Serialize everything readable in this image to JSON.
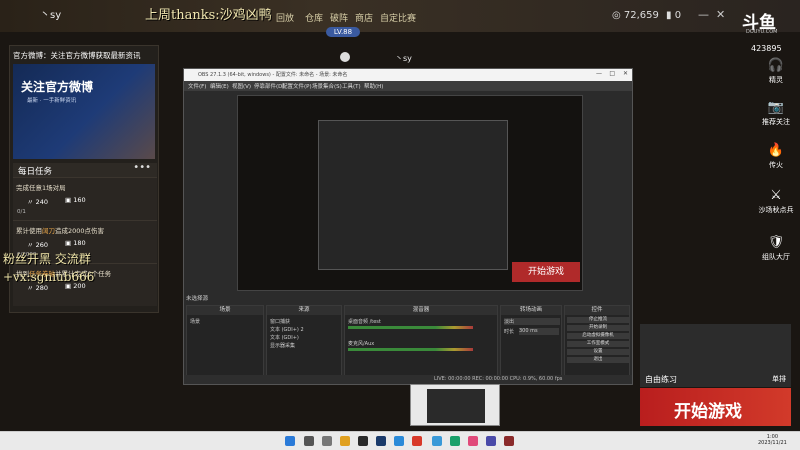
{
  "topbar": {
    "channel_name": "丶sy",
    "thanks_text": "上周thanks:沙鸡凶鸭",
    "nav": [
      "回放",
      "仓库",
      "破阵",
      "商店",
      "自定比赛"
    ],
    "coins": "72,659",
    "gold": "0",
    "level_badge": "LV.88"
  },
  "left_panel": {
    "weibo_title": "官方微博：关注官方微博获取最新资讯",
    "banner_big": "关注官方微博",
    "banner_small": "最新 · 一手新鲜资讯",
    "tasks_title": "每日任务",
    "tasks_more": "•••",
    "tasks": [
      {
        "label_pre": "完成任意1场对局",
        "label_hl": "",
        "label_post": "",
        "r1": "240",
        "r2": "160",
        "progress": "0/1"
      },
      {
        "label_pre": "累计使用",
        "label_hl": "阔刀",
        "label_post": "造成2000点伤害",
        "r1": "260",
        "r2": "180",
        "progress": "0/2000"
      },
      {
        "label_pre": "找到",
        "label_hl": "任务卷轴",
        "label_post": "并累计完成0个任务",
        "r1": "280",
        "r2": "200",
        "progress": ""
      }
    ],
    "overlay_line1": "粉丝开黑 交流群",
    "overlay_line2": "+vx:sgniub666"
  },
  "right_column": {
    "logo": "斗鱼",
    "logo_sub": "DOUYU.COM",
    "viewer_count": "423895",
    "items": [
      {
        "icon": "headset-icon",
        "glyph": "🎧",
        "label": "精灵"
      },
      {
        "icon": "camera-icon",
        "glyph": "📷",
        "label": "推荐关注"
      },
      {
        "icon": "fire-icon",
        "glyph": "🔥",
        "label": "传火"
      },
      {
        "icon": "warrior-icon",
        "glyph": "⚔",
        "label": "沙场秋点兵"
      },
      {
        "icon": "team-icon",
        "glyph": "🛡",
        "label": "组队大厅"
      }
    ]
  },
  "center": {
    "streamer": "丶sy"
  },
  "obs": {
    "title": "OBS 27.1.3 (64-bit, windows) - 配置文件: 未命名 - 场景: 未命名",
    "menus": [
      "文件(F)",
      "编辑(E)",
      "视图(V)",
      "停靠部件(D)",
      "配置文件(P)",
      "场景集合(S)",
      "工具(T)",
      "帮助(H)"
    ],
    "preview_start": "开始游戏",
    "scene_label": "未选择源",
    "docks": {
      "scenes": {
        "header": "场景",
        "items": [
          "场景"
        ]
      },
      "sources": {
        "header": "来源",
        "items": [
          "窗口捕获",
          "文本 (GDI+) 2",
          "文本 (GDI+)",
          "显示器采集"
        ]
      },
      "mixer": {
        "header": "混音器",
        "items": [
          "桌面音频 /test",
          "麦克风/Aux"
        ]
      },
      "transitions": {
        "header": "转场动画",
        "fade": "淡出",
        "duration_label": "时长",
        "duration": "300 ms"
      },
      "controls": {
        "header": "控件",
        "buttons": [
          "停止推流",
          "开始录制",
          "启动虚拟摄像机",
          "工作室模式",
          "设置",
          "退出"
        ]
      }
    },
    "status": "LIVE: 00:00:00   REC: 00:00:00   CPU: 0.9%, 60.00 fps"
  },
  "game": {
    "free_practice": "自由练习",
    "single_player": "单排",
    "start_game": "开始游戏"
  },
  "taskbar": {
    "time": "1:00",
    "date": "2023/11/21"
  }
}
